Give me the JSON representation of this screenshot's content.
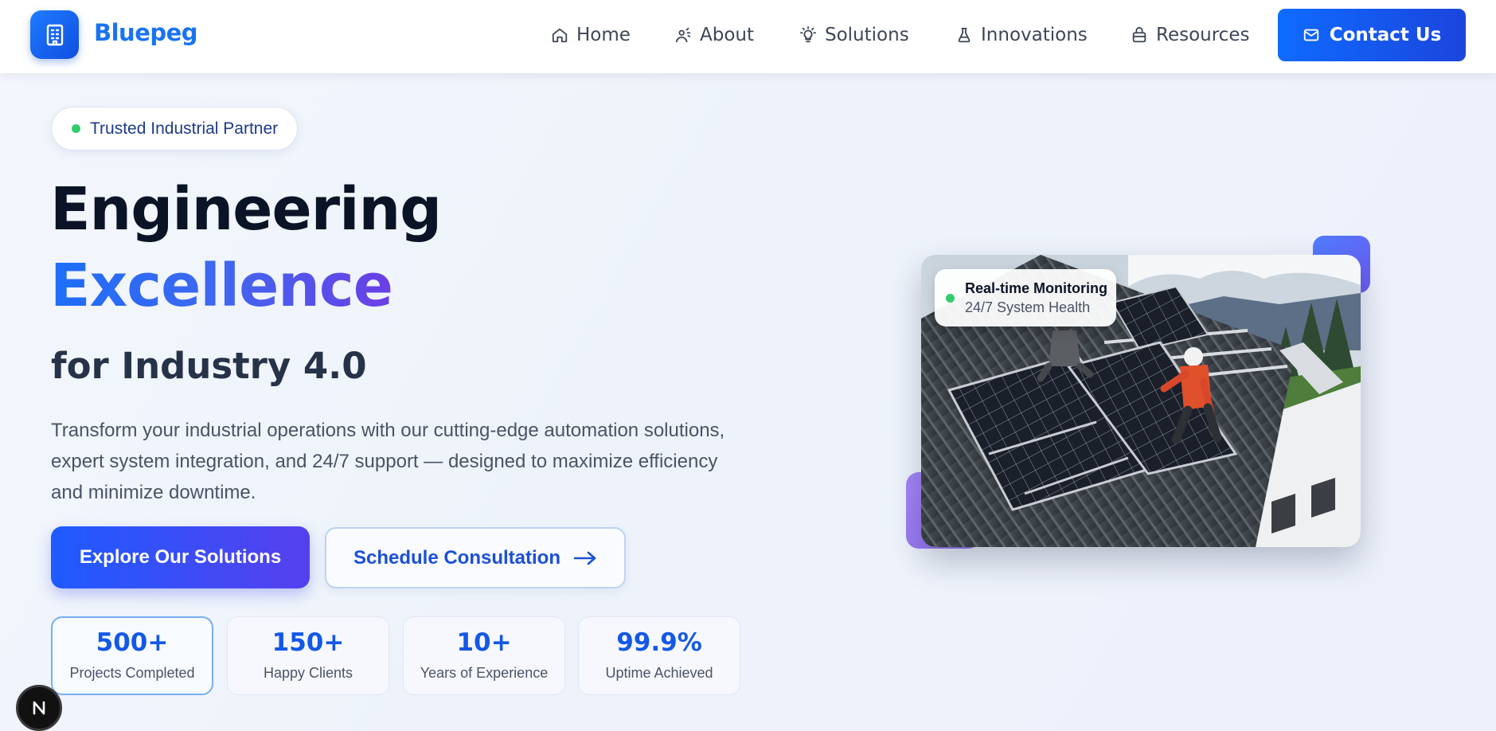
{
  "brand": {
    "name": "Bluepeg",
    "logo_icon": "building-icon",
    "accent": "#1a73f0"
  },
  "nav": {
    "items": [
      {
        "label": "Home",
        "icon": "home-icon"
      },
      {
        "label": "About",
        "icon": "user-wave-icon"
      },
      {
        "label": "Solutions",
        "icon": "lightbulb-icon"
      },
      {
        "label": "Innovations",
        "icon": "flask-icon"
      },
      {
        "label": "Resources",
        "icon": "briefcase-icon"
      }
    ],
    "contact": {
      "label": "Contact Us",
      "icon": "mail-icon"
    }
  },
  "hero": {
    "badge": "Trusted Industrial Partner",
    "headline_1": "Engineering",
    "headline_2": "Excellence",
    "headline_3": "for Industry 4.0",
    "description": "Transform your industrial operations with our cutting-edge automation solutions, expert system integration, and 24/7 support — designed to maximize efficiency and minimize downtime.",
    "primary_cta": "Explore Our Solutions",
    "secondary_cta": "Schedule Consultation",
    "secondary_cta_icon": "arrow-right-icon"
  },
  "stats": [
    {
      "value": "500+",
      "label": "Projects Completed"
    },
    {
      "value": "150+",
      "label": "Happy Clients"
    },
    {
      "value": "10+",
      "label": "Years of Experience"
    },
    {
      "value": "99.9%",
      "label": "Uptime Achieved"
    }
  ],
  "media": {
    "image_subject": "workers installing solar panels on a metal roof",
    "monitor_title": "Real-time Monitoring",
    "monitor_subtitle": "24/7 System Health",
    "status_color": "#33cc6b"
  },
  "dev_badge": {
    "letter": "N"
  }
}
